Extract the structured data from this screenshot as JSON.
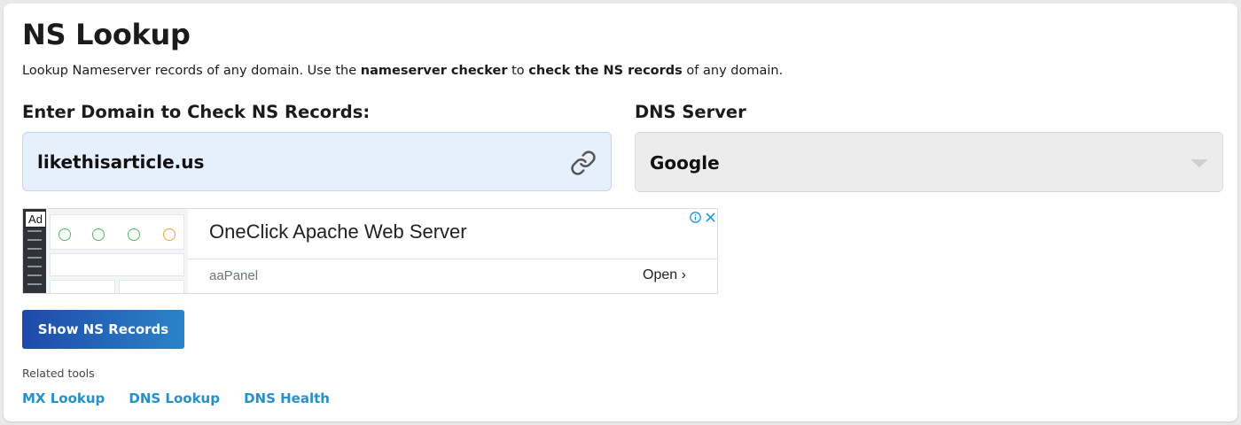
{
  "page": {
    "title": "NS Lookup",
    "description": {
      "part1": "Lookup Nameserver records of any domain. Use the ",
      "bold1": "nameserver checker",
      "part2": " to ",
      "bold2": "check the NS records",
      "part3": " of any domain."
    }
  },
  "form": {
    "domain_label": "Enter Domain to Check NS Records:",
    "domain_value": "likethisarticle.us",
    "dns_label": "DNS Server",
    "dns_selected": "Google",
    "submit_label": "Show NS Records"
  },
  "ad": {
    "badge": "Ad",
    "headline": "OneClick Apache Web Server",
    "advertiser": "aaPanel",
    "cta": "Open ›"
  },
  "related": {
    "label": "Related tools",
    "links": [
      "MX Lookup",
      "DNS Lookup",
      "DNS Health"
    ]
  },
  "colors": {
    "link": "#2690c7",
    "button_gradient_start": "#1f4aa8",
    "button_gradient_end": "#2a83c9",
    "input_background": "#e6effc",
    "select_background": "#ececec"
  },
  "icons": [
    "link-icon",
    "chevron-down-icon",
    "info-icon",
    "close-icon"
  ]
}
